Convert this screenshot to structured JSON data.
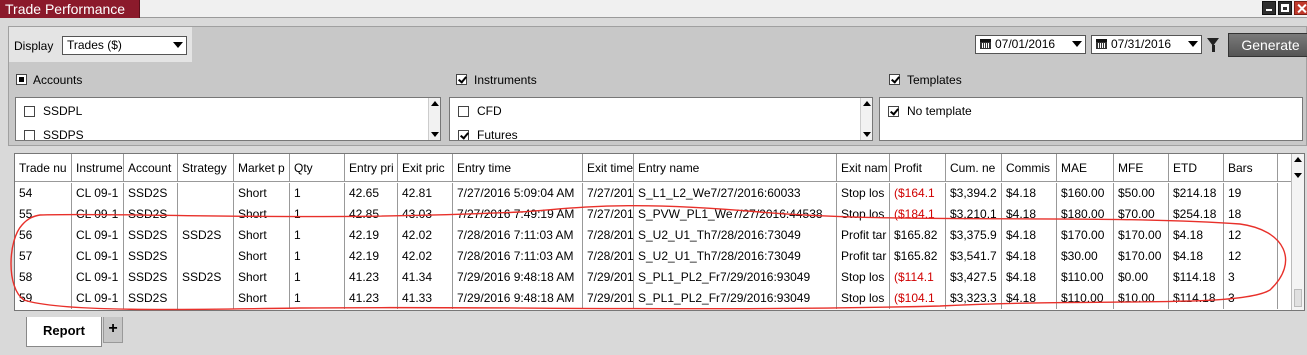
{
  "window": {
    "title": "Trade Performance"
  },
  "display": {
    "label": "Display",
    "value": "Trades ($)"
  },
  "date_from": "07/01/2016",
  "date_to": "07/31/2016",
  "generate_label": "Generate",
  "accounts": {
    "label": "Accounts",
    "items": [
      "SSDPL",
      "SSDPS"
    ]
  },
  "instruments": {
    "label": "Instruments",
    "items": [
      "CFD",
      "Futures"
    ]
  },
  "templates": {
    "label": "Templates",
    "items": [
      "No template"
    ]
  },
  "columns": [
    "Trade nu",
    "Instrume",
    "Account",
    "Strategy",
    "Market p",
    "Qty",
    "Entry pri",
    "Exit pric",
    "Entry time",
    "Exit time",
    "Entry name",
    "Exit nam",
    "Profit",
    "Cum. ne",
    "Commis",
    "MAE",
    "MFE",
    "ETD",
    "Bars"
  ],
  "rows": [
    [
      "54",
      "CL 09-1",
      "SSD2S",
      "",
      "Short",
      "1",
      "42.65",
      "42.81",
      "7/27/2016 5:09:04 AM",
      "7/27/201",
      "S_L1_L2_We7/27/2016:60033",
      "Stop los",
      "($164.1",
      "$3,394.2",
      "$4.18",
      "$160.00",
      "$50.00",
      "$214.18",
      "19"
    ],
    [
      "55",
      "CL 09-1",
      "SSD2S",
      "",
      "Short",
      "1",
      "42.85",
      "43.03",
      "7/27/2016 7:49:19 AM",
      "7/27/201",
      "S_PVW_PL1_We7/27/2016:44538",
      "Stop los",
      "($184.1",
      "$3,210.1",
      "$4.18",
      "$180.00",
      "$70.00",
      "$254.18",
      "18"
    ],
    [
      "56",
      "CL 09-1",
      "SSD2S",
      "SSD2S",
      "Short",
      "1",
      "42.19",
      "42.02",
      "7/28/2016 7:11:03 AM",
      "7/28/201",
      "S_U2_U1_Th7/28/2016:73049",
      "Profit tar",
      "$165.82",
      "$3,375.9",
      "$4.18",
      "$170.00",
      "$170.00",
      "$4.18",
      "12"
    ],
    [
      "57",
      "CL 09-1",
      "SSD2S",
      "",
      "Short",
      "1",
      "42.19",
      "42.02",
      "7/28/2016 7:11:03 AM",
      "7/28/201",
      "S_U2_U1_Th7/28/2016:73049",
      "Profit tar",
      "$165.82",
      "$3,541.7",
      "$4.18",
      "$30.00",
      "$170.00",
      "$4.18",
      "12"
    ],
    [
      "58",
      "CL 09-1",
      "SSD2S",
      "SSD2S",
      "Short",
      "1",
      "41.23",
      "41.34",
      "7/29/2016 9:48:18 AM",
      "7/29/201",
      "S_PL1_PL2_Fr7/29/2016:93049",
      "Stop los",
      "($114.1",
      "$3,427.5",
      "$4.18",
      "$110.00",
      "$0.00",
      "$114.18",
      "3"
    ],
    [
      "59",
      "CL 09-1",
      "SSD2S",
      "",
      "Short",
      "1",
      "41.23",
      "41.33",
      "7/29/2016 9:48:18 AM",
      "7/29/201",
      "S_PL1_PL2_Fr7/29/2016:93049",
      "Stop los",
      "($104.1",
      "$3,323.3",
      "$4.18",
      "$110.00",
      "$10.00",
      "$114.18",
      "3"
    ]
  ],
  "tabs": {
    "report": "Report",
    "add": "+"
  },
  "colors": {
    "title_bar": "#8b1a2b",
    "negative_profit": "#d00000",
    "annotation": "#e8302a"
  }
}
